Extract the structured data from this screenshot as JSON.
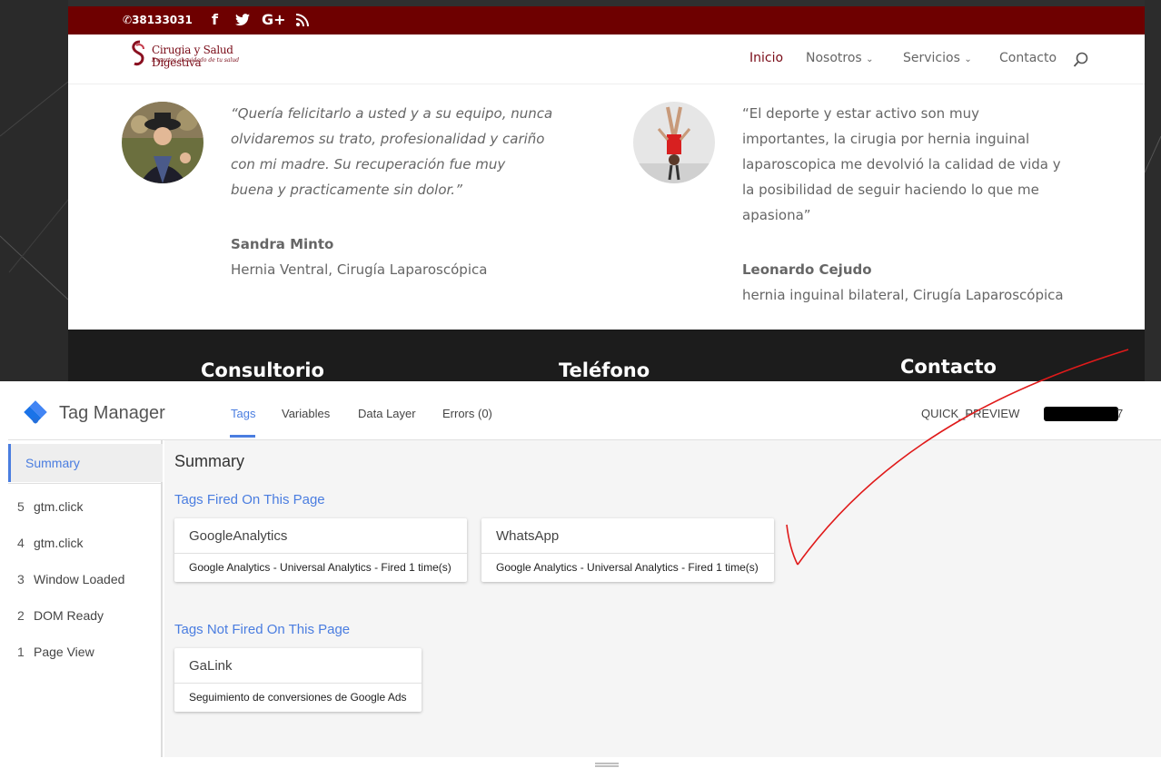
{
  "site": {
    "phone": "38133031",
    "social_icons": [
      "facebook-icon",
      "twitter-icon",
      "google-plus-icon",
      "rss-icon"
    ],
    "logo": {
      "brand": "Cirugia y Salud Digestiva",
      "tagline": "Expertos al cuidado de tu salud"
    },
    "nav": [
      {
        "label": "Inicio",
        "active": true
      },
      {
        "label": "Nosotros",
        "dropdown": true
      },
      {
        "label": "Servicios",
        "dropdown": true
      },
      {
        "label": "Contacto"
      }
    ],
    "testimonials": [
      {
        "quote_lines": [
          "“Quería felicitarlo a usted y a su equipo, nunca",
          "olvidaremos su trato, profesionalidad y cariño",
          "con mi madre. Su recuperación fue muy",
          "buena y practicamente sin dolor.”"
        ],
        "name": "Sandra Minto",
        "detail": "Hernia Ventral, Cirugía Laparoscópica"
      },
      {
        "quote_lines": [
          "“El deporte y estar activo son muy",
          "importantes, la cirugia por hernia inguinal",
          "laparoscopica me devolvió la calidad de vida y",
          "la posibilidad de seguir haciendo lo que me",
          "apasiona”"
        ],
        "name": "Leonardo Cejudo",
        "detail": "hernia inguinal bilateral, Cirugía Laparoscópica"
      }
    ],
    "footer_headings": [
      "Consultorio",
      "Teléfono",
      "Contacto"
    ]
  },
  "tag_manager": {
    "title": "Tag Manager",
    "tabs": [
      {
        "label": "Tags",
        "active": true
      },
      {
        "label": "Variables"
      },
      {
        "label": "Data Layer"
      },
      {
        "label": "Errors (0)"
      }
    ],
    "preview_label": "QUICK_PREVIEW",
    "container_suffix": "7",
    "sidebar": {
      "summary": "Summary",
      "events": [
        {
          "num": "5",
          "label": "gtm.click"
        },
        {
          "num": "4",
          "label": "gtm.click"
        },
        {
          "num": "3",
          "label": "Window Loaded"
        },
        {
          "num": "2",
          "label": "DOM Ready"
        },
        {
          "num": "1",
          "label": "Page View"
        }
      ]
    },
    "main": {
      "title": "Summary",
      "fired_title": "Tags Fired On This Page",
      "fired": [
        {
          "name": "GoogleAnalytics",
          "desc": "Google Analytics - Universal Analytics - Fired 1 time(s)"
        },
        {
          "name": "WhatsApp",
          "desc": "Google Analytics - Universal Analytics - Fired 1 time(s)"
        }
      ],
      "not_fired_title": "Tags Not Fired On This Page",
      "not_fired": [
        {
          "name": "GaLink",
          "desc": "Seguimiento de conversiones de Google Ads"
        }
      ]
    }
  },
  "colors": {
    "topbar": "#6e0000",
    "brand": "#7a0c18",
    "accent": "#4a7de0",
    "annotation": "#e01a1a"
  }
}
